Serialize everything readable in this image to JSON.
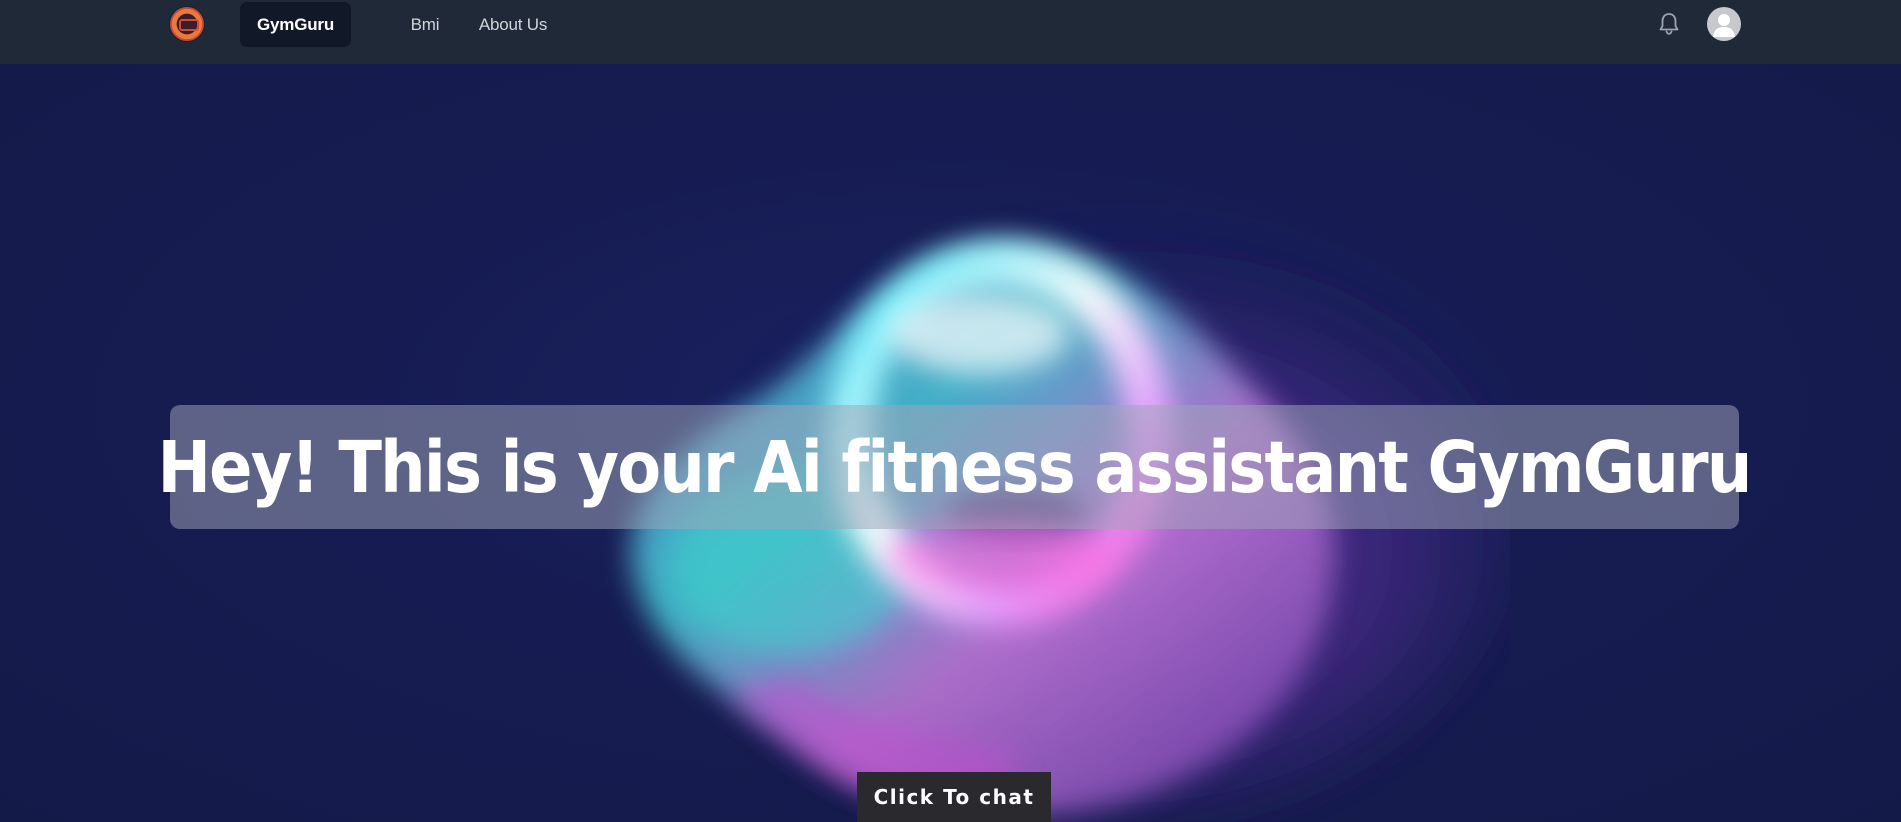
{
  "navbar": {
    "logo_icon": "gymguru-logo-icon",
    "items": [
      {
        "label": "GymGuru",
        "active": true
      },
      {
        "label": "Bmi",
        "active": false
      },
      {
        "label": "About Us",
        "active": false
      }
    ],
    "notification_icon": "bell-icon",
    "avatar_icon": "user-avatar-icon"
  },
  "hero": {
    "headline": "Hey! This is your Ai fitness assistant GymGuru",
    "cta_label": "Click To chat"
  },
  "colors": {
    "navbar_bg": "#1f2937",
    "active_tab_bg": "#111827",
    "hero_bg": "#141b4a",
    "cta_bg": "#2a2a2e"
  }
}
